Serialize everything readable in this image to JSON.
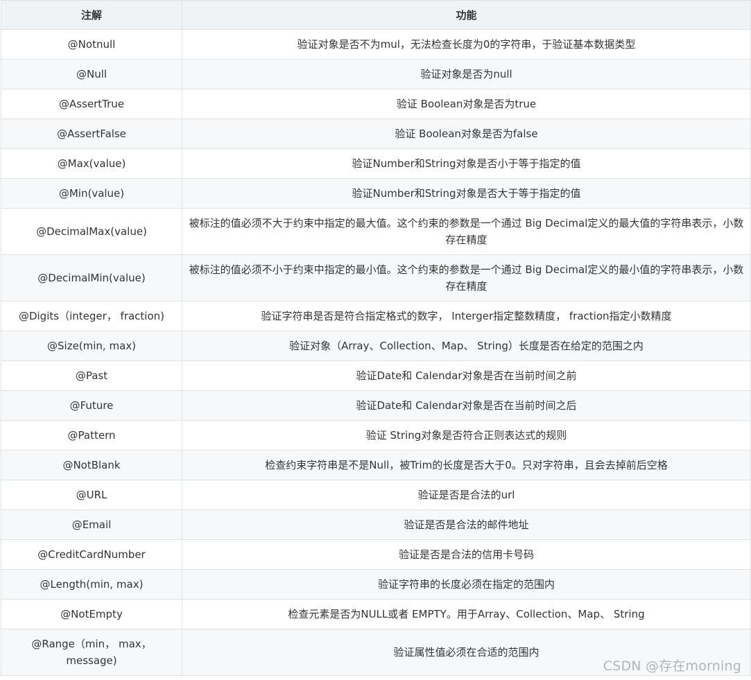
{
  "table": {
    "headers": [
      "注解",
      "功能"
    ],
    "rows": [
      {
        "annotation": "@Notnull",
        "function": "验证对象是否不为mul，无法检查长度为0的字符串，于验证基本数据类型"
      },
      {
        "annotation": "@Null",
        "function": "验证对象是否为null"
      },
      {
        "annotation": "@AssertTrue",
        "function": "验证 Boolean对象是否为true"
      },
      {
        "annotation": "@AssertFalse",
        "function": "验证 Boolean对象是否为false"
      },
      {
        "annotation": "@Max(value)",
        "function": "验证Number和String对象是否小于等于指定的值"
      },
      {
        "annotation": "@Min(value)",
        "function": "验证Number和String对象是否大于等于指定的值"
      },
      {
        "annotation": "@DecimalMax(value)",
        "function": "被标注的值必须不大于约束中指定的最大值。这个约束的参数是一个通过 Big Decimal定义的最大值的字符串表示，小数存在精度"
      },
      {
        "annotation": "@DecimalMin(value)",
        "function": "被标注的值必须不小于约束中指定的最小值。这个约束的参数是一个通过 Big Decimal定义的最小值的字符串表示，小数存在精度"
      },
      {
        "annotation": "@Digits（integer， fraction)",
        "function": "验证字符串是否是符合指定格式的数字， Interger指定整数精度， fraction指定小数精度"
      },
      {
        "annotation": "@Size(min, max)",
        "function": "验证对象（Array、Collection、Map、 String）长度是否在给定的范围之内"
      },
      {
        "annotation": "@Past",
        "function": "验证Date和 Calendar对象是否在当前时间之前"
      },
      {
        "annotation": "@Future",
        "function": "验证Date和 Calendar对象是否在当前时间之后"
      },
      {
        "annotation": "@Pattern",
        "function": "验证 String对象是否符合正则表达式的规则"
      },
      {
        "annotation": "@NotBlank",
        "function": "检查约束字符串是不是Null，被Trim的长度是否大于0。只对字符串，且会去掉前后空格"
      },
      {
        "annotation": "@URL",
        "function": "验证是否是合法的url"
      },
      {
        "annotation": "@Email",
        "function": "验证是否是合法的邮件地址"
      },
      {
        "annotation": "@CreditCardNumber",
        "function": "验证是否是合法的信用卡号码"
      },
      {
        "annotation": "@Length(min, max)",
        "function": "验证字符串的长度必须在指定的范围内"
      },
      {
        "annotation": "@NotEmpty",
        "function": "检查元素是否为NULL或者 EMPTY。用于Array、Collection、Map、 String"
      },
      {
        "annotation": "@Range（min， max，message)",
        "function": "验证属性值必须在合适的范围内"
      }
    ]
  },
  "watermark": "CSDN @存在morning"
}
